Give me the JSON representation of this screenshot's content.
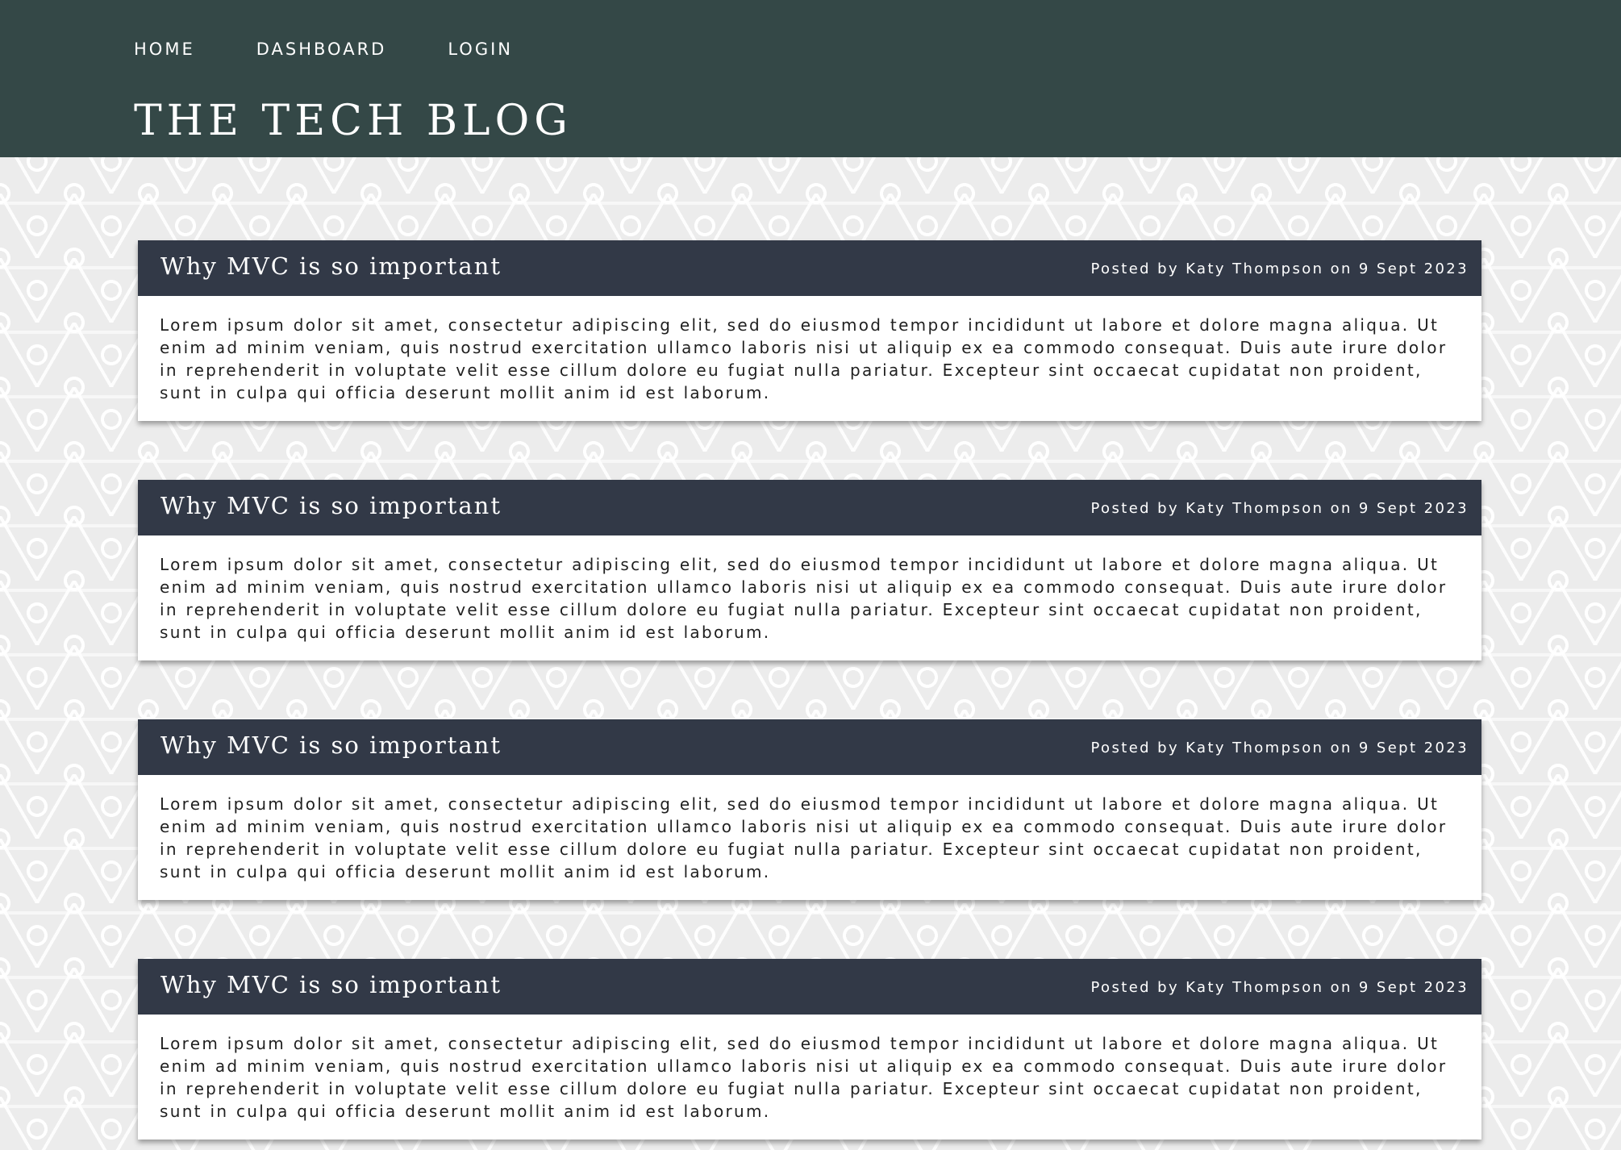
{
  "nav": {
    "items": [
      {
        "label": "HOME"
      },
      {
        "label": "DASHBOARD"
      },
      {
        "label": "LOGIN"
      }
    ]
  },
  "site": {
    "title": "THE TECH BLOG"
  },
  "posts": [
    {
      "title": "Why MVC is so important",
      "meta": "Posted by Katy Thompson on 9 Sept 2023",
      "body": "Lorem ipsum dolor sit amet, consectetur adipiscing elit, sed do eiusmod tempor incididunt ut labore et dolore magna aliqua. Ut enim ad minim veniam, quis nostrud exercitation ullamco laboris nisi ut aliquip ex ea commodo consequat. Duis aute irure dolor in reprehenderit in voluptate velit esse cillum dolore eu fugiat nulla pariatur. Excepteur sint occaecat cupidatat non proident, sunt in culpa qui officia deserunt mollit anim id est laborum."
    },
    {
      "title": "Why MVC is so important",
      "meta": "Posted by Katy Thompson on 9 Sept 2023",
      "body": "Lorem ipsum dolor sit amet, consectetur adipiscing elit, sed do eiusmod tempor incididunt ut labore et dolore magna aliqua. Ut enim ad minim veniam, quis nostrud exercitation ullamco laboris nisi ut aliquip ex ea commodo consequat. Duis aute irure dolor in reprehenderit in voluptate velit esse cillum dolore eu fugiat nulla pariatur. Excepteur sint occaecat cupidatat non proident, sunt in culpa qui officia deserunt mollit anim id est laborum."
    },
    {
      "title": "Why MVC is so important",
      "meta": "Posted by Katy Thompson on 9 Sept 2023",
      "body": "Lorem ipsum dolor sit amet, consectetur adipiscing elit, sed do eiusmod tempor incididunt ut labore et dolore magna aliqua. Ut enim ad minim veniam, quis nostrud exercitation ullamco laboris nisi ut aliquip ex ea commodo consequat. Duis aute irure dolor in reprehenderit in voluptate velit esse cillum dolore eu fugiat nulla pariatur. Excepteur sint occaecat cupidatat non proident, sunt in culpa qui officia deserunt mollit anim id est laborum."
    },
    {
      "title": "Why MVC is so important",
      "meta": "Posted by Katy Thompson on 9 Sept 2023",
      "body": "Lorem ipsum dolor sit amet, consectetur adipiscing elit, sed do eiusmod tempor incididunt ut labore et dolore magna aliqua. Ut enim ad minim veniam, quis nostrud exercitation ullamco laboris nisi ut aliquip ex ea commodo consequat. Duis aute irure dolor in reprehenderit in voluptate velit esse cillum dolore eu fugiat nulla pariatur. Excepteur sint occaecat cupidatat non proident, sunt in culpa qui officia deserunt mollit anim id est laborum."
    }
  ],
  "colors": {
    "header_bg": "#344847",
    "post_header_bg": "#323947",
    "page_bg": "#ececec",
    "card_bg": "#ffffff",
    "header_text": "#ffffff",
    "body_text": "#1f1f1f"
  }
}
